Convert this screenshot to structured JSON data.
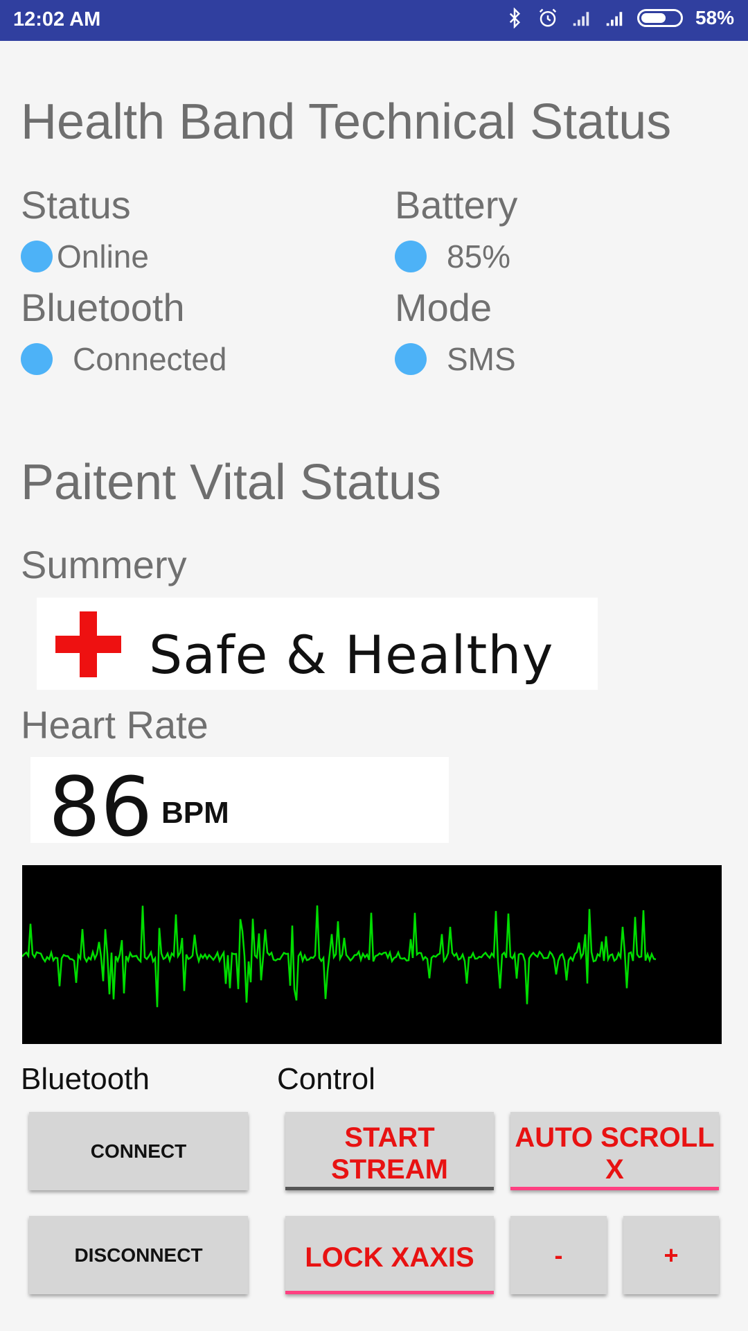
{
  "status_bar": {
    "time": "12:02 AM",
    "battery_pct": "58%",
    "icons": [
      "bluetooth-icon",
      "alarm-icon",
      "signal-icon",
      "signal-icon",
      "battery-icon"
    ]
  },
  "technical": {
    "title": "Health Band Technical Status",
    "status_label": "Status",
    "status_value": "Online",
    "battery_label": "Battery",
    "battery_value": "85%",
    "bluetooth_label": "Bluetooth",
    "bluetooth_value": "Connected",
    "mode_label": "Mode",
    "mode_value": "SMS"
  },
  "vital": {
    "title": "Paitent Vital Status",
    "summary_label": "Summery",
    "summary_text": "Safe & Healthy",
    "heart_rate_label": "Heart Rate",
    "heart_rate_value": "86",
    "heart_rate_unit": "BPM"
  },
  "controls": {
    "bluetooth_label": "Bluetooth",
    "control_label": "Control",
    "connect": "CONNECT",
    "disconnect": "DISCONNECT",
    "start_stream": "START STREAM",
    "auto_scroll": "AUTO SCROLL X",
    "lock_xaxis": "LOCK XAXIS",
    "minus": "-",
    "plus": "+"
  },
  "colors": {
    "status_bar": "#303f9f",
    "dot": "#4db2f7",
    "button_text_red": "#e81212",
    "underline_pink": "#ff4081",
    "underline_gray": "#555555",
    "ecg_line": "#00dd00"
  }
}
